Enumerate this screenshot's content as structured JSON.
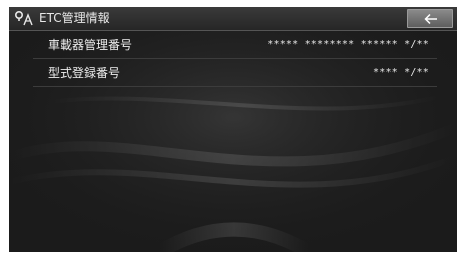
{
  "header": {
    "title": "ETC管理情報",
    "icon": "etc-card-icon",
    "back_icon": "back-arrow-icon"
  },
  "rows": [
    {
      "label": "車載器管理番号",
      "value": "***** ******** ****** */**"
    },
    {
      "label": "型式登録番号",
      "value": "**** */**"
    }
  ],
  "colors": {
    "background": "#1b1b1b",
    "header": "#2e2e2e",
    "back_button": "#727272",
    "text": "#ededed"
  }
}
